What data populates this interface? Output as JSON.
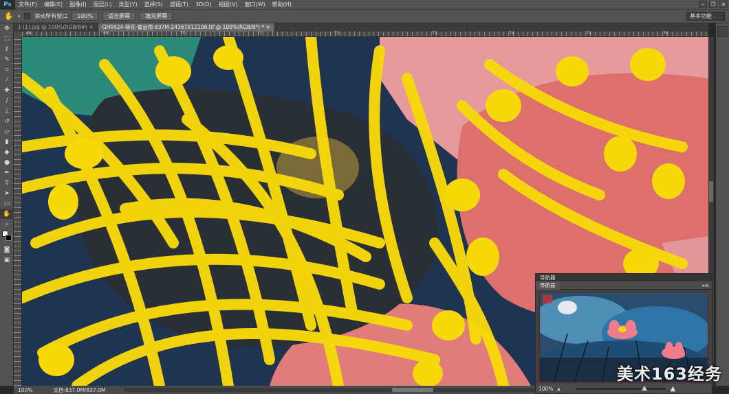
{
  "app": {
    "logo": "Ps"
  },
  "menu": [
    "文件(F)",
    "编辑(E)",
    "图像(I)",
    "图层(L)",
    "类型(Y)",
    "选择(S)",
    "滤镜(T)",
    "3D(D)",
    "视图(V)",
    "窗口(W)",
    "帮助(H)"
  ],
  "window_controls": {
    "minimize": "–",
    "restore": "❐",
    "close": "✕"
  },
  "options": {
    "tool_icon": "hand-icon",
    "scroll_all_label": "滚动所有窗口",
    "zoom_100_label": "100%",
    "fit_screen_label": "适合屏幕",
    "fill_screen_label": "填充屏幕",
    "workspace": "基本功能"
  },
  "tabs": [
    {
      "label": "1 (1).jpg @ 100%(RGB/8#)",
      "close": "×",
      "active": false
    },
    {
      "label": "GH0424-荷花-雷运雨-837M-24167X12106.tif @ 100%(RGB/8*) *",
      "close": "×",
      "active": true
    }
  ],
  "ruler_ticks": [
    "68",
    "69",
    "70",
    "71",
    "72",
    "73",
    "74",
    "75",
    "76"
  ],
  "tools": [
    "move",
    "marquee",
    "lasso",
    "quick-select",
    "crop",
    "eyedropper",
    "healing",
    "brush",
    "stamp",
    "history-brush",
    "eraser",
    "gradient",
    "blur",
    "dodge",
    "pen",
    "type",
    "path-select",
    "shape",
    "hand",
    "zoom",
    "swatch",
    "quick-mask",
    "screen-mode"
  ],
  "status": {
    "zoom": "100%",
    "doc_info": "文档:837.0M/837.0M"
  },
  "navigator": {
    "title": "导航器",
    "tab": "导航器",
    "menu": "▸≡",
    "zoom": "100%"
  },
  "watermark": "美术163经务",
  "colors": {
    "accent": "#f7d90a",
    "canvas_pink": "#e07c7a",
    "canvas_blue": "#2f4a6a"
  }
}
